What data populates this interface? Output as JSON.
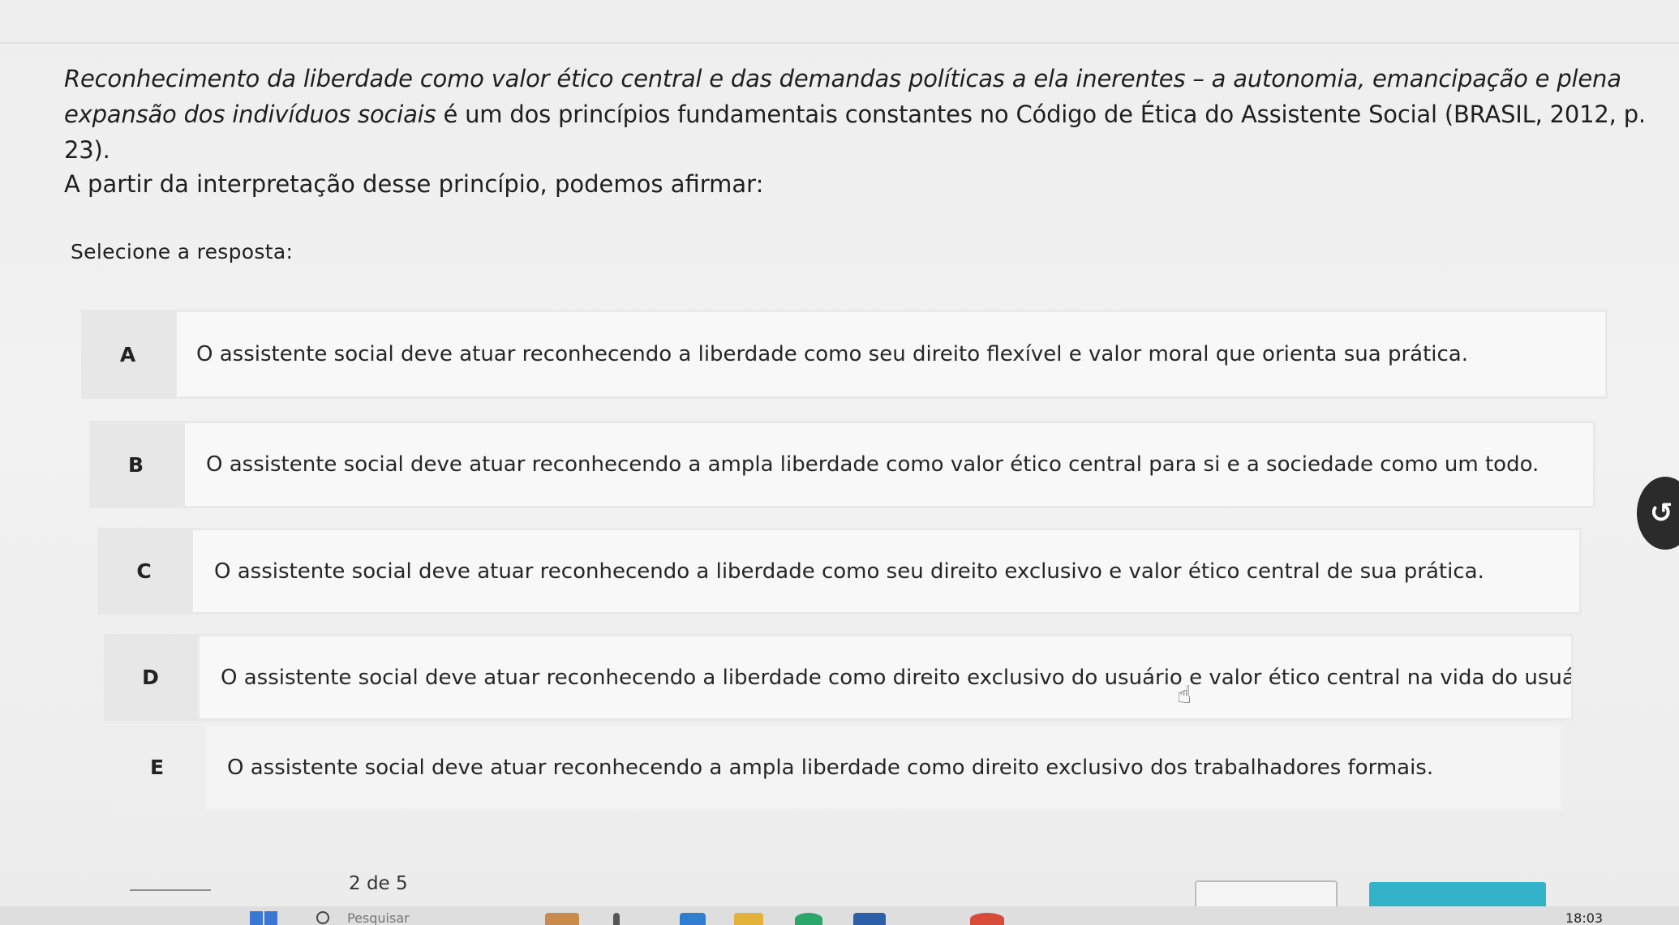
{
  "question": {
    "statement_italic": "Reconhecimento da liberdade como valor ético central e das demandas políticas a ela inerentes – a autonomia, emancipação e plena expansão dos indivíduos sociais",
    "statement_regular": " é um dos princípios fundamentais constantes no Código de Ética do Assistente Social (BRASIL, 2012, p. 23).",
    "prompt": "A partir da interpretação desse princípio, podemos afirmar:",
    "select_label": "Selecione a resposta:"
  },
  "options": [
    {
      "letter": "A",
      "text": "O assistente social deve atuar reconhecendo a liberdade como seu direito flexível e valor moral que orienta sua prática."
    },
    {
      "letter": "B",
      "text": "O assistente social deve atuar reconhecendo a ampla liberdade como valor ético central para si e a sociedade como um todo."
    },
    {
      "letter": "C",
      "text": "O assistente social deve atuar reconhecendo a liberdade como seu direito exclusivo e valor ético central de sua prática."
    },
    {
      "letter": "D",
      "text": "O assistente social deve atuar reconhecendo a liberdade como direito exclusivo do usuário e valor ético central na vida do usuário."
    },
    {
      "letter": "E",
      "text": "O assistente social deve atuar reconhecendo a ampla liberdade como direito exclusivo dos trabalhadores formais."
    }
  ],
  "pagination": {
    "label": "2 de 5"
  },
  "taskbar": {
    "search_placeholder": "Pesquisar",
    "clock": "18:03",
    "start_icon": "windows-logo-icon",
    "accent_color": "#32b3c7"
  }
}
